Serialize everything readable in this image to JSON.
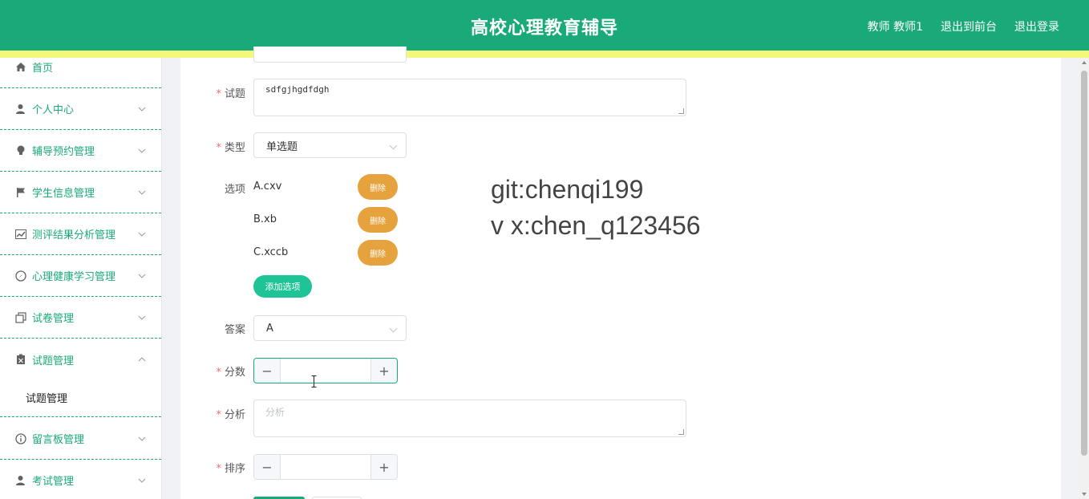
{
  "header": {
    "title": "高校心理教育辅导",
    "user_label": "教师 教师1",
    "front_label": "退出到前台",
    "logout_label": "退出登录"
  },
  "sidebar": {
    "items": [
      {
        "label": "首页",
        "icon": "home-icon"
      },
      {
        "label": "个人中心",
        "icon": "user-icon"
      },
      {
        "label": "辅导预约管理",
        "icon": "bulb-icon"
      },
      {
        "label": "学生信息管理",
        "icon": "flag-icon"
      },
      {
        "label": "测评结果分析管理",
        "icon": "chart-icon"
      },
      {
        "label": "心理健康学习管理",
        "icon": "compass-icon"
      },
      {
        "label": "试卷管理",
        "icon": "copy-icon"
      },
      {
        "label": "试题管理",
        "icon": "clipboard-icon"
      },
      {
        "label": "留言板管理",
        "icon": "info-icon"
      },
      {
        "label": "考试管理",
        "icon": "user-icon"
      }
    ],
    "sub_item": "试题管理"
  },
  "form": {
    "question_label": "试题",
    "question_value": "sdfgjhgdfdgh",
    "type_label": "类型",
    "type_value": "单选题",
    "options_label": "选项",
    "options": [
      "A.cxv",
      "B.xb",
      "C.xccb"
    ],
    "delete_label": "删除",
    "add_option_label": "添加选项",
    "answer_label": "答案",
    "answer_value": "A",
    "score_label": "分数",
    "score_value": "",
    "analysis_label": "分析",
    "analysis_placeholder": "分析",
    "sort_label": "排序",
    "sort_value": ""
  },
  "watermark": {
    "line1": "git:chenqi199",
    "line2": "v x:chen_q123456"
  },
  "colors": {
    "primary": "#1aaa7a",
    "accent_bar": "#f3f77a",
    "delete": "#e6a23c",
    "add": "#1ec496"
  }
}
